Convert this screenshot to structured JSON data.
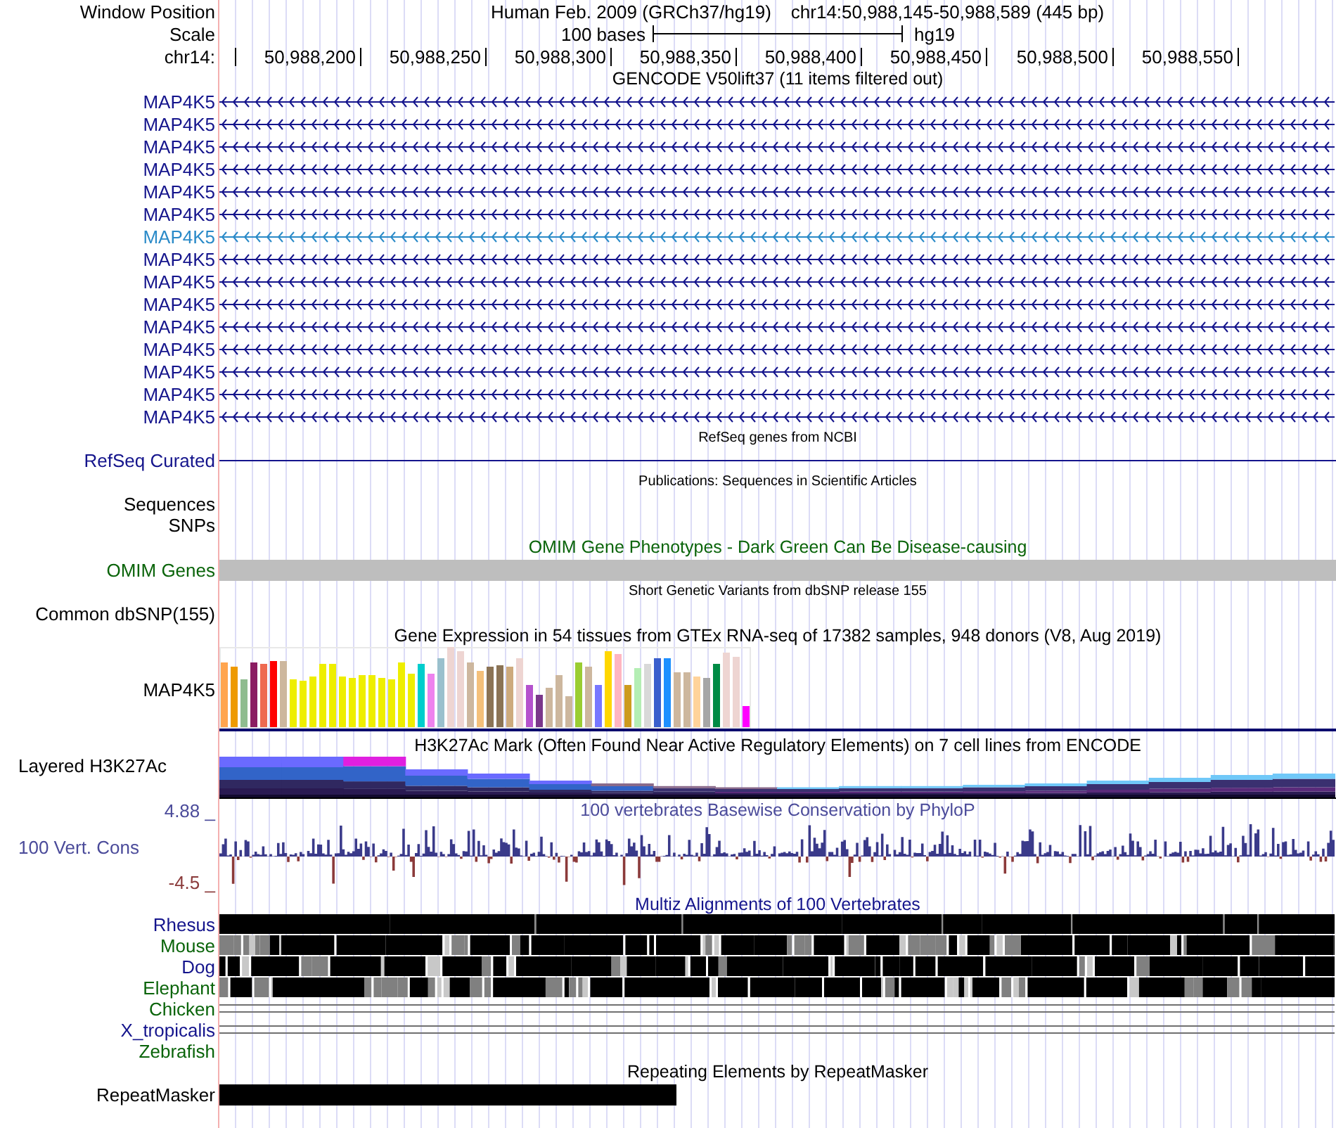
{
  "header": {
    "window_position_label": "Window Position",
    "assembly": "Human Feb. 2009 (GRCh37/hg19)",
    "position": "chr14:50,988,145-50,988,589 (445 bp)",
    "scale_label": "Scale",
    "scale_text": "100 bases",
    "scale_assembly": "hg19",
    "chrom_label": "chr14:",
    "ruler_labels": [
      "50,988,200",
      "50,988,250",
      "50,988,300",
      "50,988,350",
      "50,988,400",
      "50,988,450",
      "50,988,500",
      "50,988,550"
    ]
  },
  "tracks": [
    {
      "kind": "genes",
      "title": "GENCODE V50lift37 (11 items filtered out)",
      "color": "#14148c",
      "items": [
        {
          "label": "MAP4K5",
          "selected": false
        },
        {
          "label": "MAP4K5",
          "selected": false
        },
        {
          "label": "MAP4K5",
          "selected": false
        },
        {
          "label": "MAP4K5",
          "selected": false
        },
        {
          "label": "MAP4K5",
          "selected": false
        },
        {
          "label": "MAP4K5",
          "selected": false
        },
        {
          "label": "MAP4K5",
          "selected": true
        },
        {
          "label": "MAP4K5",
          "selected": false
        },
        {
          "label": "MAP4K5",
          "selected": false
        },
        {
          "label": "MAP4K5",
          "selected": false
        },
        {
          "label": "MAP4K5",
          "selected": false
        },
        {
          "label": "MAP4K5",
          "selected": false
        },
        {
          "label": "MAP4K5",
          "selected": false
        },
        {
          "label": "MAP4K5",
          "selected": false
        },
        {
          "label": "MAP4K5",
          "selected": false
        }
      ]
    },
    {
      "kind": "line",
      "title": "RefSeq genes from NCBI",
      "label": "RefSeq Curated",
      "color": "#14148c"
    },
    {
      "kind": "empty",
      "title": "Publications: Sequences in Scientific Articles",
      "labels": [
        "Sequences",
        "SNPs"
      ],
      "color": "#000000"
    },
    {
      "kind": "bar",
      "title": "OMIM Gene Phenotypes - Dark Green Can Be Disease-causing",
      "label": "OMIM Genes",
      "color": "#0a640a"
    },
    {
      "kind": "empty",
      "title": "Short Genetic Variants from dbSNP release 155",
      "labels": [
        "Common dbSNP(155)"
      ],
      "color": "#000000"
    },
    {
      "kind": "expression",
      "title": "Gene Expression in 54 tissues from GTEx RNA-seq of 17382 samples, 948 donors (V8, Aug 2019)",
      "label": "MAP4K5",
      "color": "#000000"
    },
    {
      "kind": "layered",
      "title": "H3K27Ac Mark (Often Found Near Active Regulatory Elements) on 7 cell lines from ENCODE",
      "label": "Layered H3K27Ac",
      "color": "#000000"
    },
    {
      "kind": "conservation",
      "title": "100 vertebrates Basewise Conservation by PhyloP",
      "label": "100 Vert. Cons",
      "y_max": "4.88 _",
      "y_min": "-4.5 _",
      "color": "#4b4b9a"
    },
    {
      "kind": "multiz",
      "title": "Multiz Alignments of 100 Vertebrates",
      "color": "#14148c",
      "species": [
        {
          "name": "Rhesus",
          "kind": "blocks",
          "color": "#14148c"
        },
        {
          "name": "Mouse",
          "kind": "blocks",
          "color": "#0a640a"
        },
        {
          "name": "Dog",
          "kind": "blocks",
          "color": "#14148c"
        },
        {
          "name": "Elephant",
          "kind": "blocks",
          "color": "#0a640a"
        },
        {
          "name": "Chicken",
          "kind": "lines",
          "color": "#0a640a"
        },
        {
          "name": "X_tropicalis",
          "kind": "lines",
          "color": "#14148c"
        },
        {
          "name": "Zebrafish",
          "kind": "none",
          "color": "#0a640a"
        }
      ]
    },
    {
      "kind": "repeat",
      "title": "Repeating Elements by RepeatMasker",
      "label": "RepeatMasker",
      "color": "#000000"
    }
  ]
}
